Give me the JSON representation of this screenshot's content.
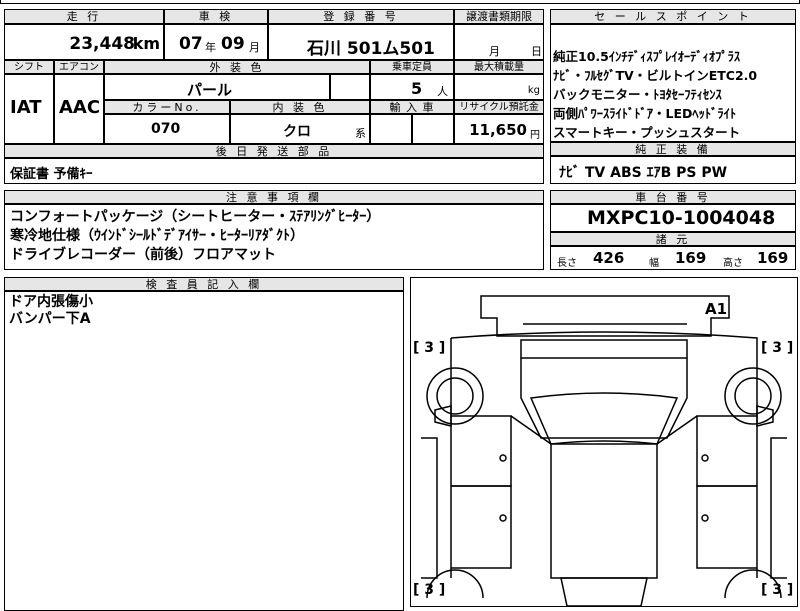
{
  "top": {
    "headers": {
      "mileage": "走 行",
      "inspection": "車 検",
      "registration": "登 録 番 号",
      "transfer_deadline": "譲渡書類期限",
      "sales_points": "セ ー ル ス ポ イ ン ト"
    },
    "mileage_value": "23,448",
    "mileage_unit": "km",
    "inspection_year": "07",
    "year_unit": "年",
    "inspection_month": "09",
    "month_unit": "月",
    "plate": "石川 501ム501",
    "deadline_month_unit": "月",
    "deadline_day_unit": "日"
  },
  "spec": {
    "headers": {
      "shift": "シフト",
      "aircon": "エアコン",
      "exterior": "外 装 色",
      "capacity": "乗車定員",
      "max_load": "最大積載量",
      "color_no": "カラーNo.",
      "interior": "内 装 色",
      "import": "輸 入 車",
      "recycle": "リサイクル預託金"
    },
    "shift": "IAT",
    "aircon": "AAC",
    "exterior": "パール",
    "capacity": "5",
    "capacity_unit": "人",
    "load_unit": "kg",
    "color_no": "070",
    "interior": "クロ",
    "interior_suffix": "系",
    "recycle": "11,650",
    "recycle_unit": "円"
  },
  "sales_points": [
    "純正10.5ｲﾝﾁﾃﾞｨｽﾌﾟﾚｲｵｰﾃﾞｨｵﾌﾟﾗｽ",
    "ﾅﾋﾞ・ﾌﾙｾｸﾞTV・ビルトインETC2.0",
    "バックモニター・ﾄﾖﾀｾｰﾌﾃｨｾﾝｽ",
    "両側ﾊﾟﾜｰｽﾗｲﾄﾞﾄﾞｱ・LEDﾍｯﾄﾞﾗｲﾄ",
    "スマートキー・プッシュスタート"
  ],
  "later_parts": {
    "header": "後 日 発 送 部 品",
    "value": "保証書 予備ｷｰ"
  },
  "oem_equipment": {
    "header": "純 正 装 備",
    "value": "ﾅﾋﾞ TV ABS ｴｱB PS PW"
  },
  "notes": {
    "header": "注 意 事 項 欄",
    "lines": [
      "コンフォートパッケージ（シートヒーター・ｽﾃｱﾘﾝｸﾞﾋｰﾀｰ）",
      "寒冷地仕様（ｳｲﾝﾄﾞｼｰﾙﾄﾞﾃﾞｱｲｻｰ・ﾋｰﾀｰﾘｱﾀﾞｸﾄ）",
      "ドライブレコーダー（前後）フロアマット"
    ]
  },
  "chassis": {
    "header": "車 台 番 号",
    "value": "MXPC10-1004048"
  },
  "dims": {
    "header": "諸 元",
    "length_label": "長さ",
    "length": "426",
    "width_label": "幅",
    "width": "169",
    "height_label": "高さ",
    "height": "169"
  },
  "inspector": {
    "header": "検 査 員 記 入 欄",
    "lines": [
      "ドア内張傷小",
      "バンパー下A"
    ]
  },
  "diagram": {
    "mark_a1": "A1",
    "tire_labels": [
      "[ 3 ]",
      "[ 3 ]",
      "[ 3 ]",
      "[ 3 ]"
    ]
  }
}
